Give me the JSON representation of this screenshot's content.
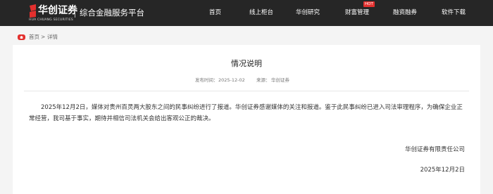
{
  "header": {
    "logo_cn": "华创证券",
    "logo_en": "HUA CHUANG SECURITIES",
    "slogan": "综合金融服务平台",
    "brand_color": "#e3302e",
    "nav": [
      "首页",
      "线上柜台",
      "华创研究",
      "财富管理",
      "融资融券",
      "软件下载"
    ],
    "hot_badge": "HOT"
  },
  "breadcrumb": {
    "home": "首页",
    "separator": ">",
    "current": "详情"
  },
  "article": {
    "title": "情况说明",
    "publish_label": "发布时间：",
    "publish_date": "2025-12-02",
    "source_label": "来源：",
    "source": "华创证券",
    "paragraph": "2025年12月2日，媒体对贵州百灵两大股东之间的民事纠纷进行了报道。华创证券感谢媒体的关注和报道。鉴于此民事纠纷已进入司法审理程序，为确保企业正常经营，我司基于事实，期待并相信司法机关会给出客观公正的裁决。",
    "signature_company": "华创证券有限责任公司",
    "signature_date": "2025年12月2日"
  }
}
